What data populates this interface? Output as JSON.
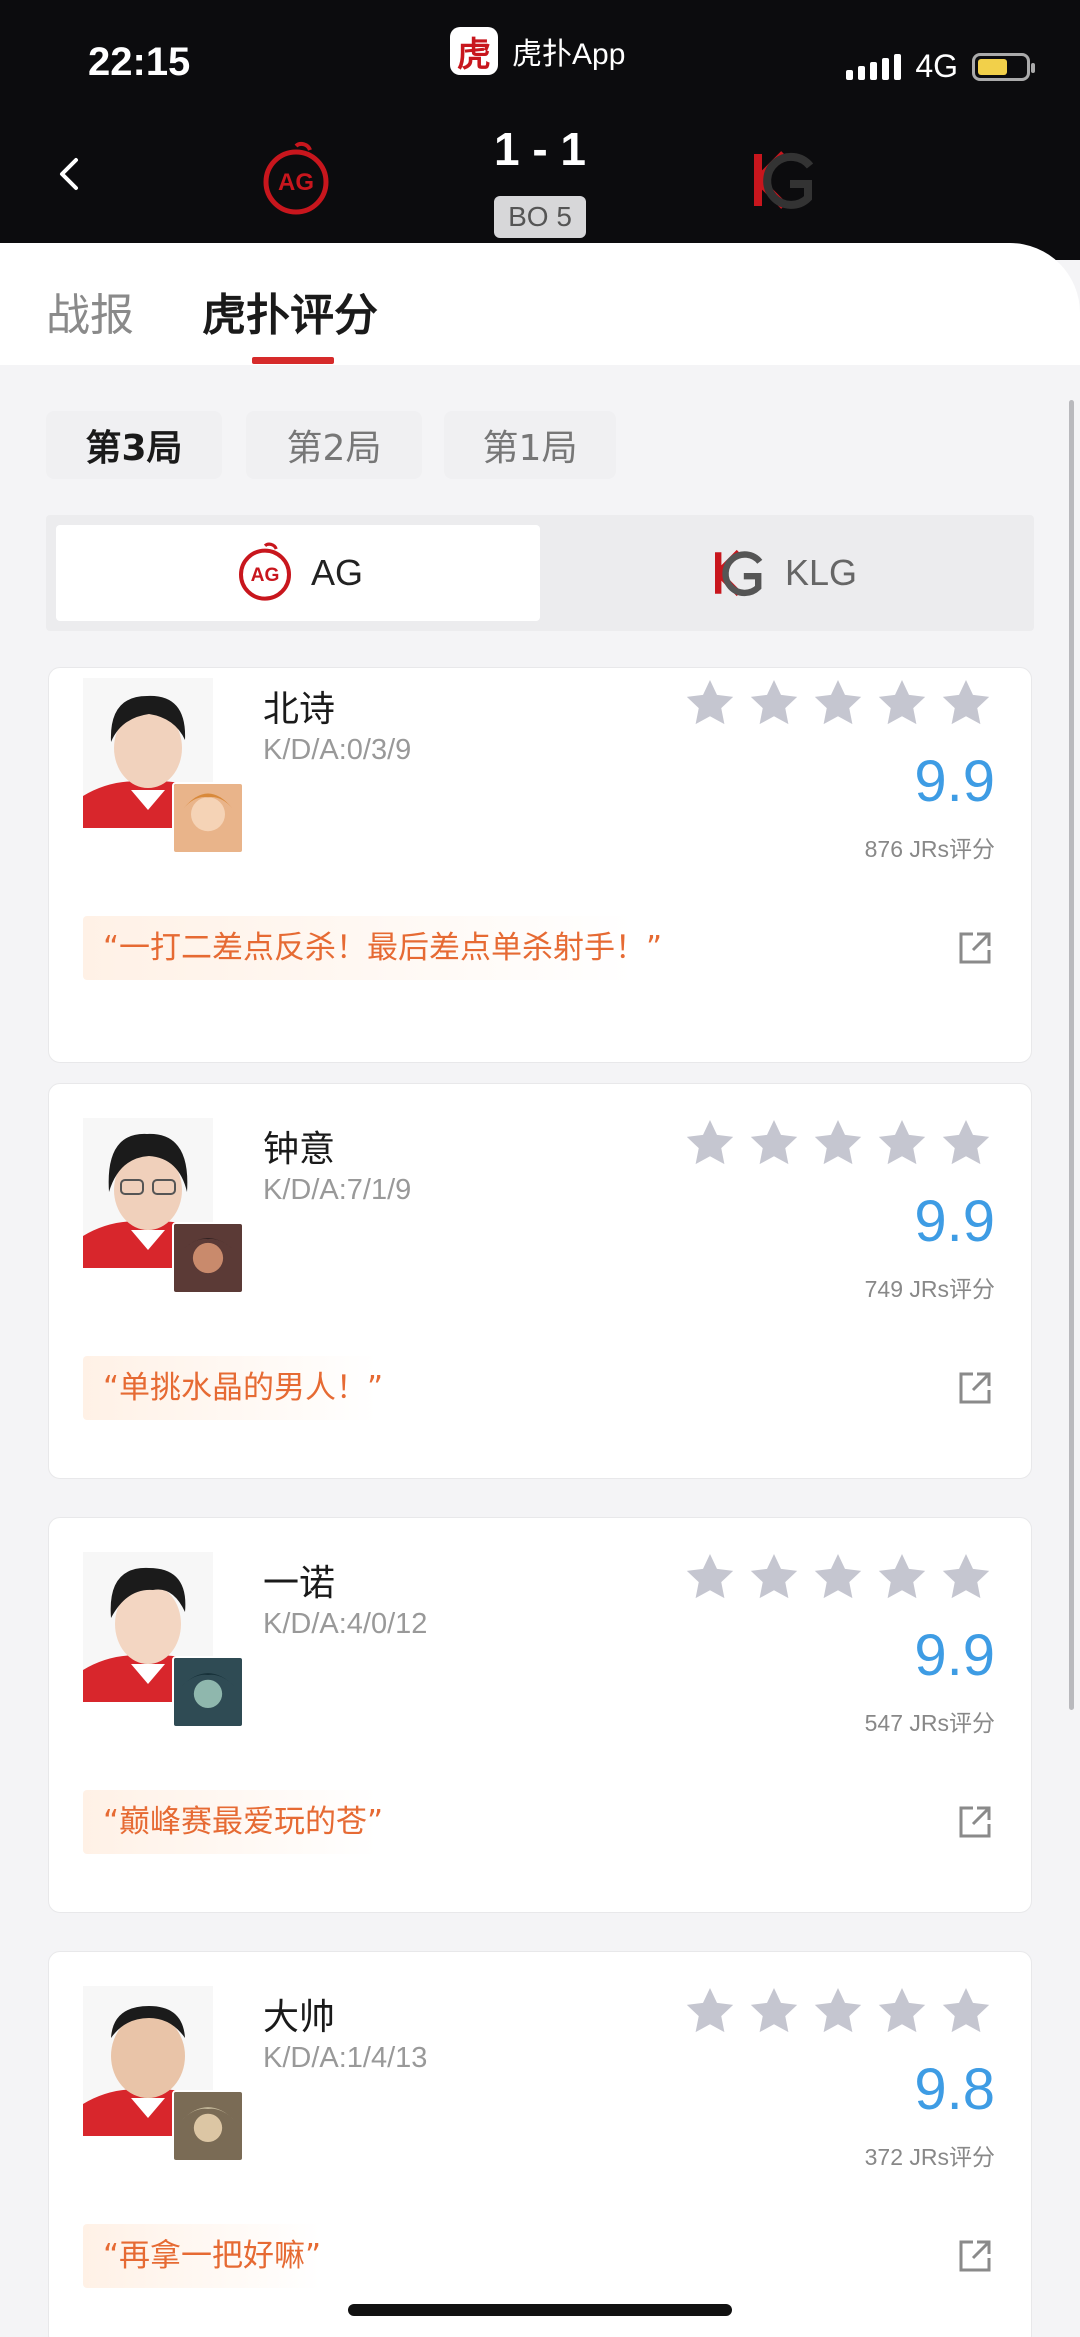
{
  "status_bar": {
    "time": "22:15",
    "app_name": "虎扑App",
    "app_logo_text": "虎扑",
    "network": "4G"
  },
  "match": {
    "score": "1 - 1",
    "format": "BO 5",
    "home_team": "AG",
    "away_team": "KLG"
  },
  "tabs": [
    {
      "label": "战报"
    },
    {
      "label": "虎扑评分"
    }
  ],
  "game_tabs": [
    {
      "label": "第3局"
    },
    {
      "label": "第2局"
    },
    {
      "label": "第1局"
    }
  ],
  "team_switch": [
    {
      "name": "AG"
    },
    {
      "name": "KLG"
    }
  ],
  "players": [
    {
      "name": "北诗",
      "kda": "K/D/A:0/3/9",
      "rating": "9.9",
      "votes": "876 JRs评分",
      "quote": "“一打二差点反杀！最后差点单杀射手！”"
    },
    {
      "name": "钟意",
      "kda": "K/D/A:7/1/9",
      "rating": "9.9",
      "votes": "749 JRs评分",
      "quote": "“单挑水晶的男人！”"
    },
    {
      "name": "一诺",
      "kda": "K/D/A:4/0/12",
      "rating": "9.9",
      "votes": "547 JRs评分",
      "quote": "“巅峰赛最爱玩的苍”"
    },
    {
      "name": "大帅",
      "kda": "K/D/A:1/4/13",
      "rating": "9.8",
      "votes": "372 JRs评分",
      "quote": "“再拿一把好嘛”"
    }
  ],
  "colors": {
    "accent": "#d62a2a",
    "rating": "#3e9ce4",
    "quote": "#e66a33",
    "star": "#c5c6d0"
  },
  "icons": {
    "back": "chevron-left-icon",
    "share": "share-external-icon",
    "star": "star-icon"
  }
}
